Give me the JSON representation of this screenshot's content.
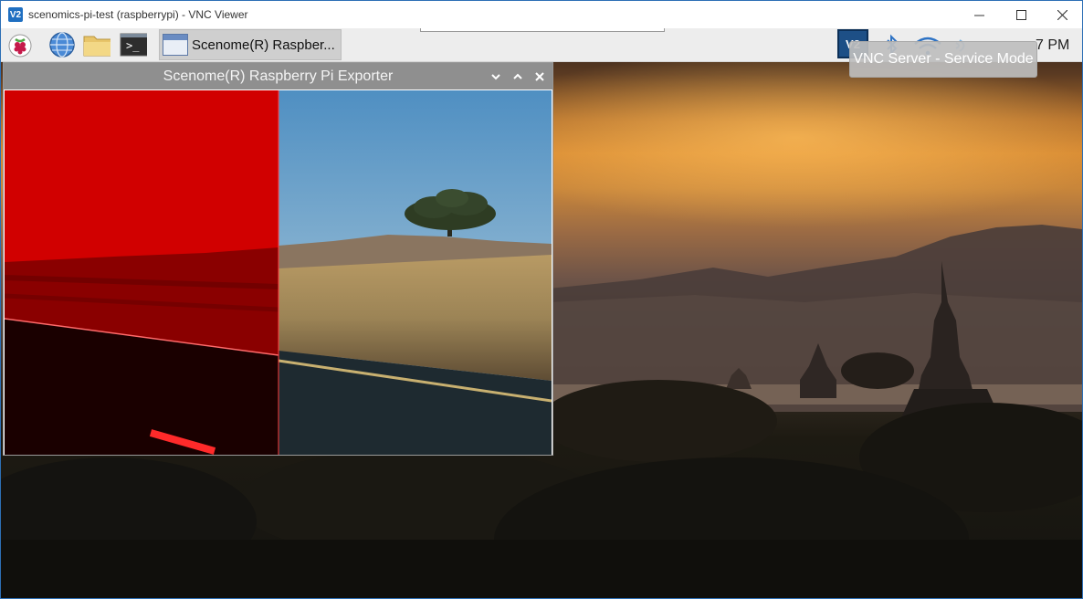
{
  "window": {
    "app_icon": "V2",
    "title": "scenomics-pi-test (raspberrypi) - VNC Viewer",
    "minimize_icon": "minimize-icon",
    "maximize_icon": "maximize-icon",
    "close_icon": "close-icon"
  },
  "panel": {
    "launcher_icons": [
      "raspberry-menu-icon",
      "web-browser-icon",
      "file-manager-icon",
      "terminal-icon"
    ],
    "terminal_glyph": ">_",
    "taskbar_item_label": "Scenome(R) Raspber...",
    "vnc_icon_text": "V2",
    "clock": "7 PM",
    "tooltip": "VNC Server - Service Mode"
  },
  "app_window": {
    "title": "Scenome(R) Raspberry Pi Exporter"
  },
  "colors": {
    "accent_blue": "#1d4f86",
    "panel_bg": "#ededed",
    "app_titlebar": "#8f8f8f",
    "red_overlay": "#d10000"
  }
}
